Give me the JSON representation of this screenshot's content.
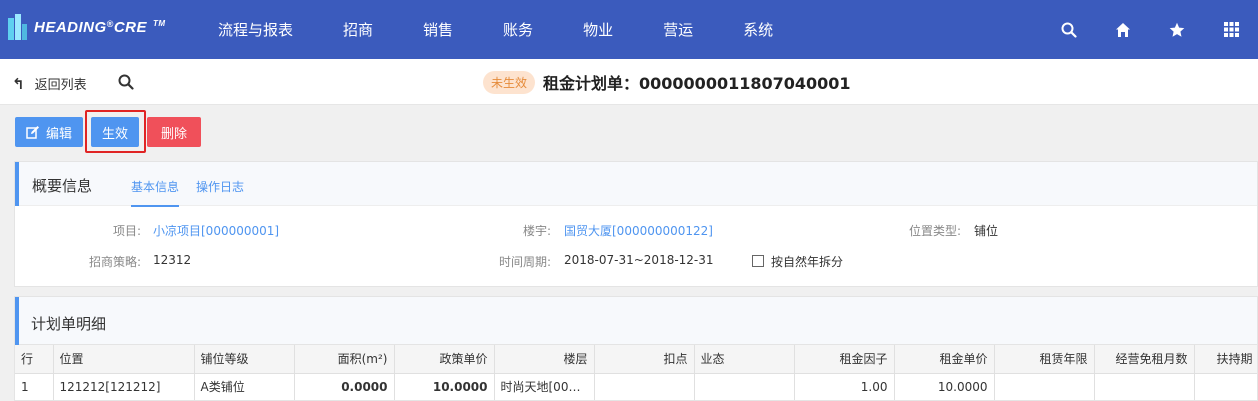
{
  "nav": {
    "logo_text": "HEADING",
    "logo_reg": "®",
    "logo_text2": "CRE",
    "logo_tm": "TM",
    "menu": [
      "流程与报表",
      "招商",
      "销售",
      "账务",
      "物业",
      "营运",
      "系统"
    ],
    "icons": [
      "search-icon",
      "home-icon",
      "star-icon",
      "grid-icon"
    ]
  },
  "subheader": {
    "back_label": "返回列表",
    "status_badge": "未生效",
    "title": "租金计划单：0000000011807040001"
  },
  "actions": {
    "edit_label": "编辑",
    "activate_label": "生效",
    "delete_label": "删除"
  },
  "summary": {
    "title": "概要信息",
    "tabs": [
      "基本信息",
      "操作日志"
    ],
    "project_label": "项目:",
    "project_value": "小凉项目[000000001]",
    "building_label": "楼宇:",
    "building_value": "国贸大厦[000000000122]",
    "position_type_label": "位置类型:",
    "position_type_value": "铺位",
    "strategy_label": "招商策略:",
    "strategy_value": "12312",
    "period_label": "时间周期:",
    "period_value": "2018-07-31~2018-12-31",
    "split_label": "按自然年拆分"
  },
  "plan": {
    "title": "计划单明细",
    "columns": [
      "行",
      "位置",
      "铺位等级",
      "面积(m²)",
      "政策单价",
      "楼层",
      "扣点",
      "业态",
      "租金因子",
      "租金单价",
      "租赁年限",
      "经营免租月数",
      "扶持期"
    ],
    "rows": [
      [
        "1",
        "121212[121212]",
        "A类铺位",
        "0.0000",
        "10.0000",
        "时尚天地[000...",
        "",
        "",
        "1.00",
        "10.0000",
        "",
        "",
        ""
      ]
    ]
  },
  "colors": {
    "nav_bg": "#3b5bbd",
    "primary": "#4f95f0",
    "danger": "#f0505a",
    "badge_bg": "#fde3cf",
    "badge_text": "#e58b3a"
  }
}
